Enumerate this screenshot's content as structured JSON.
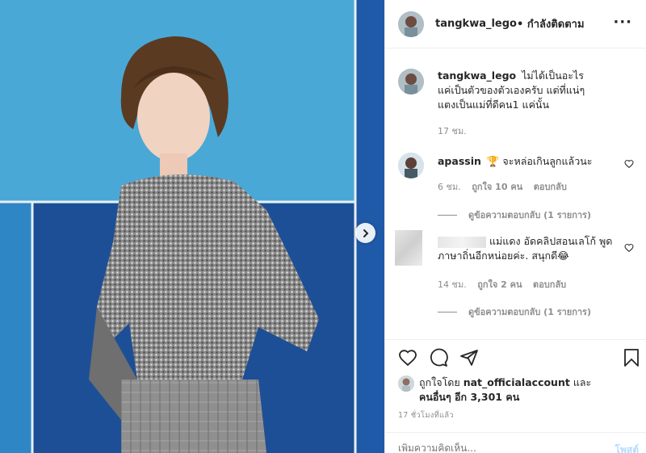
{
  "post": {
    "username": "tangkwa_lego",
    "follow_label": "• กำลังติดตาม",
    "more_icon": "ellipsis-icon"
  },
  "caption": {
    "username": "tangkwa_lego",
    "text": "ไม่ได้เป็นอะไร แค่เป็นตัวของตัวเองครับ แต่ที่แน่ๆ แตงเป็นแม่ที่ดีคน1 แค่นั้น",
    "time": "17 ชม."
  },
  "comments": [
    {
      "username": "apassin",
      "text": "🏆 จะหล่อเกินลูกแล้วนะ",
      "time": "6 ชม.",
      "likes": "ถูกใจ 10 คน",
      "reply": "ตอบกลับ",
      "view_replies": "ดูข้อความตอบกลับ (1 รายการ)"
    },
    {
      "username": "",
      "text": "แม่แดง อัดคลิปสอนเลโก้ พูดภาษาถิ่นอีกหน่อยค่ะ. สนุกดี😂",
      "time": "14 ชม.",
      "likes": "ถูกใจ 2 คน",
      "reply": "ตอบกลับ",
      "view_replies": "ดูข้อความตอบกลับ (1 รายการ)"
    }
  ],
  "likes": {
    "prefix": "ถูกใจโดย",
    "user": "nat_officialaccount",
    "and": "และ",
    "others": "คนอื่นๆ อีก 3,301 คน"
  },
  "time_ago": "17 ชั่วโมงที่แล้ว",
  "add_comment": {
    "placeholder": "เพิ่มความคิดเห็น...",
    "post_label": "โพสต์"
  },
  "colors": {
    "photo_bg": "#3f9fd0",
    "panel_dark": "#1f4e9a",
    "text": "#262626",
    "muted": "#8e8e8e",
    "post_disabled": "#b3dbff"
  }
}
